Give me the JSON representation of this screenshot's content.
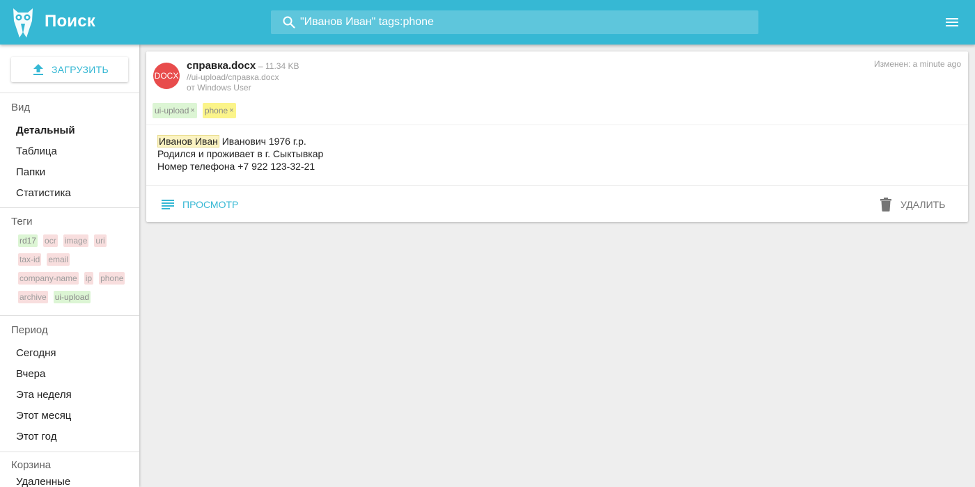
{
  "header": {
    "title": "Поиск",
    "search_query": "\"Иванов Иван\" tags:phone",
    "colors": {
      "primary": "#36b8d4"
    }
  },
  "sidebar": {
    "upload_label": "ЗАГРУЗИТЬ",
    "view_section": {
      "title": "Вид",
      "items": [
        {
          "label": "Детальный",
          "active": true
        },
        {
          "label": "Таблица",
          "active": false
        },
        {
          "label": "Папки",
          "active": false
        },
        {
          "label": "Статистика",
          "active": false
        }
      ]
    },
    "tags_section": {
      "title": "Теги",
      "rows": [
        [
          {
            "label": "rd17",
            "color": "green"
          },
          {
            "label": "ocr",
            "color": "red"
          },
          {
            "label": "image",
            "color": "red"
          },
          {
            "label": "uri",
            "color": "red"
          }
        ],
        [
          {
            "label": "tax-id",
            "color": "red"
          },
          {
            "label": "email",
            "color": "red"
          }
        ],
        [
          {
            "label": "company-name",
            "color": "red"
          },
          {
            "label": "ip",
            "color": "red"
          },
          {
            "label": "phone",
            "color": "red"
          }
        ],
        [
          {
            "label": "archive",
            "color": "red"
          },
          {
            "label": "ui-upload",
            "color": "green"
          }
        ]
      ]
    },
    "period_section": {
      "title": "Период",
      "items": [
        {
          "label": "Сегодня"
        },
        {
          "label": "Вчера"
        },
        {
          "label": "Эта неделя"
        },
        {
          "label": "Этот месяц"
        },
        {
          "label": "Этот год"
        }
      ]
    },
    "trash_section": {
      "title": "Корзина",
      "items": [
        {
          "label": "Удаленные"
        }
      ]
    }
  },
  "result": {
    "file_type": "DOCX",
    "file_name": "справка.docx",
    "file_size": "– 11.34 KB",
    "path": "//ui-upload/справка.docx",
    "author": "от Windows User",
    "modified": "Изменен: a minute ago",
    "tags": [
      {
        "label": "ui-upload",
        "color": "green",
        "remove": "×"
      },
      {
        "label": "phone",
        "color": "yellow",
        "remove": "×"
      }
    ],
    "snippet": {
      "highlight": "Иванов Иван",
      "line1_rest": " Иванович 1976 г.р.",
      "line2": "Родился и проживает в г. Сыктывкар",
      "line3": "Номер телефона +7 922 123-32-21"
    },
    "view_label": "ПРОСМОТР",
    "delete_label": "УДАЛИТЬ"
  }
}
